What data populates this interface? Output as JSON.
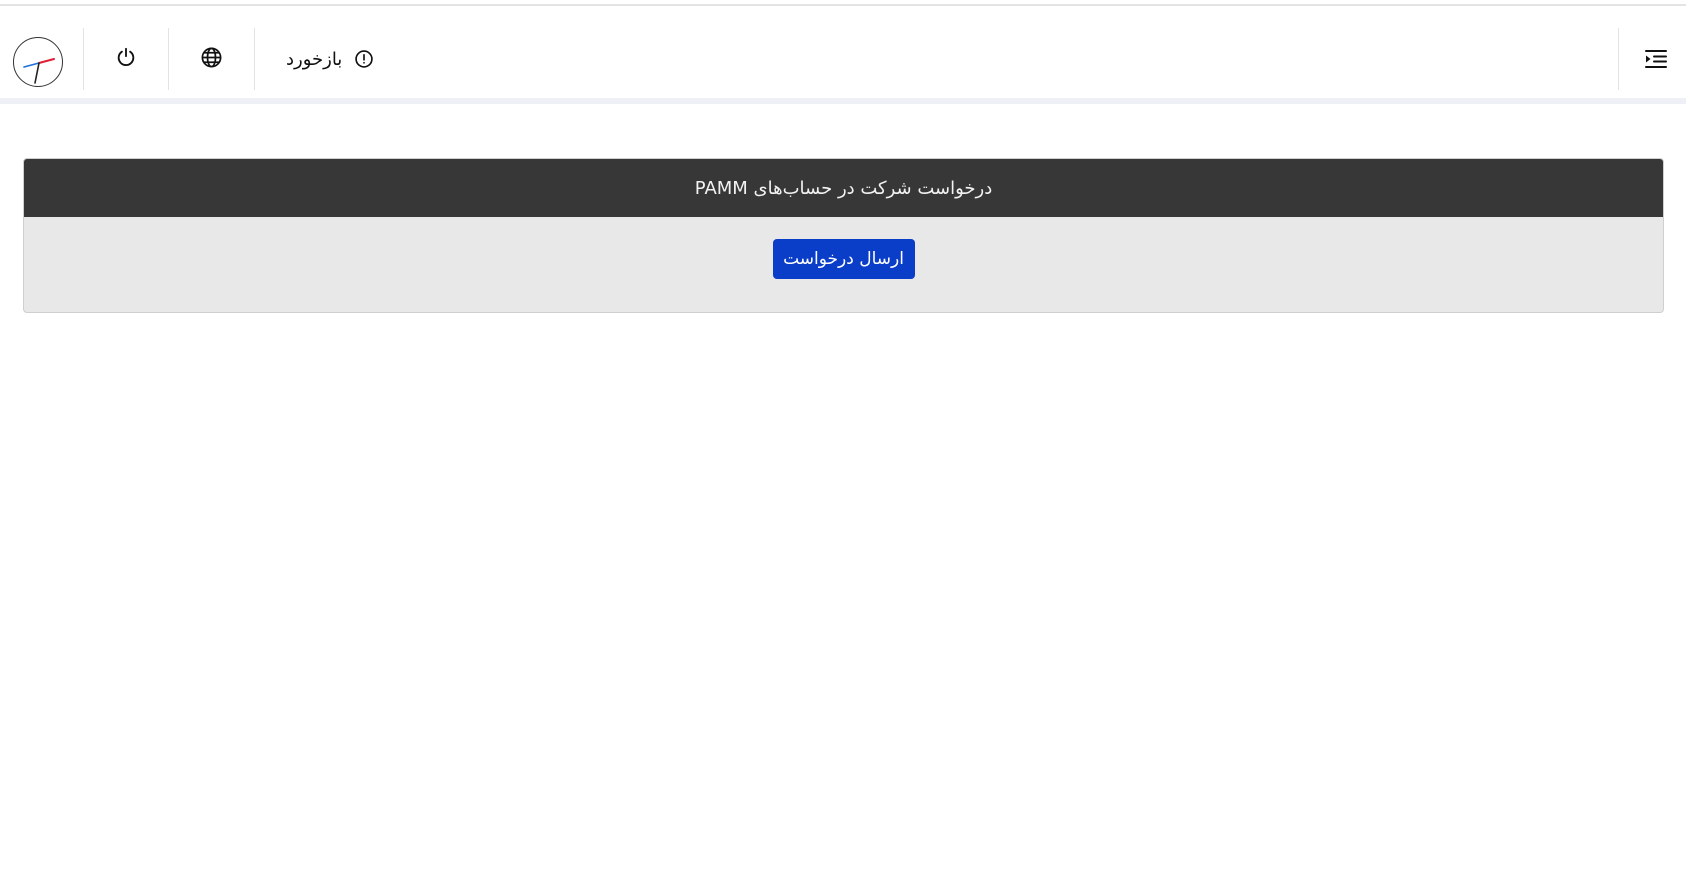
{
  "header": {
    "feedback_label": "بازخورد",
    "icons": {
      "avatar": "analog-clock-logo",
      "power": "power-icon",
      "language": "globe-icon",
      "feedback": "exclamation-circle-icon",
      "menu": "indent-menu-icon"
    }
  },
  "card": {
    "title": "درخواست شرکت در حساب‌های PAMM",
    "submit_label": "ارسال درخواست"
  },
  "colors": {
    "card_header_bg": "#373737",
    "card_body_bg": "#e8e8e8",
    "primary_button": "#0a3ec9",
    "clock_hand_red": "#e01e37",
    "clock_hand_blue": "#1e6fd9"
  }
}
